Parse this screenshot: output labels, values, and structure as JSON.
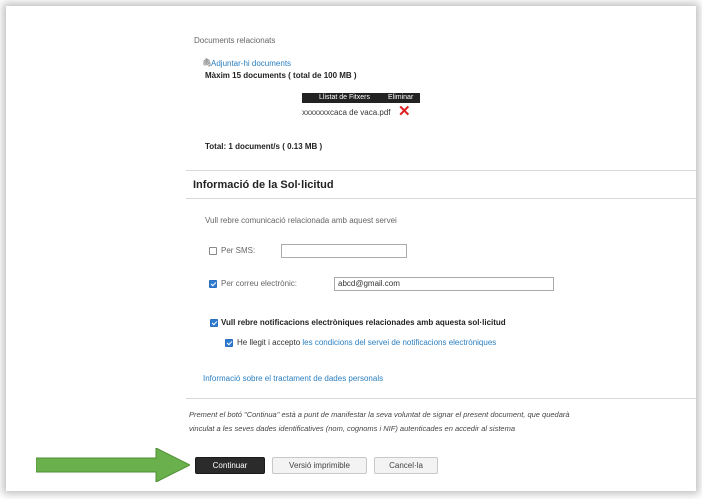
{
  "documents": {
    "header": "Documents relacionats",
    "attach_link": "Adjuntar-hi documents",
    "max_info": "Màxim 15 documents ( total de 100 MB )",
    "table_headers": [
      "Llistat de Fitxers",
      "Eliminar"
    ],
    "files": [
      {
        "name": "xxxxxxxcaca de vaca.pdf"
      }
    ],
    "total": "Total: 1 document/s ( 0.13 MB )"
  },
  "info_section": {
    "title": "Informació de la Sol·licitud",
    "prompt": "Vull rebre comunicació relacionada amb aquest servei",
    "sms": {
      "label": "Per SMS:",
      "checked": false,
      "value": ""
    },
    "email": {
      "label": "Per correu electrònic:",
      "checked": true,
      "value": "abcd@gmail.com"
    },
    "notifications": {
      "label": "Vull rebre notificacions electròniques relacionades amb aquesta sol·licitud",
      "checked": true
    },
    "accept": {
      "prefix": "He llegit i accepto",
      "link": "les condicions del servei de notificacions electròniques",
      "checked": true
    },
    "privacy_link": "Informació sobre el tractament de dades personals"
  },
  "footer": {
    "notice_line1": "Prement el botó \"Continua\" està a punt de manifestar la seva voluntat de signar el present document, que quedarà",
    "notice_line2": "vinculat a les seves dades identificatives (nom, cognoms i NIF) autenticades en accedir al sistema",
    "buttons": {
      "continue": "Continuar",
      "print": "Versió imprimible",
      "cancel": "Cancel·la"
    }
  },
  "colors": {
    "accent": "#2f7bd0",
    "link": "#2a7fc1",
    "arrow": "#6ab04c",
    "delete": "#e02020"
  }
}
